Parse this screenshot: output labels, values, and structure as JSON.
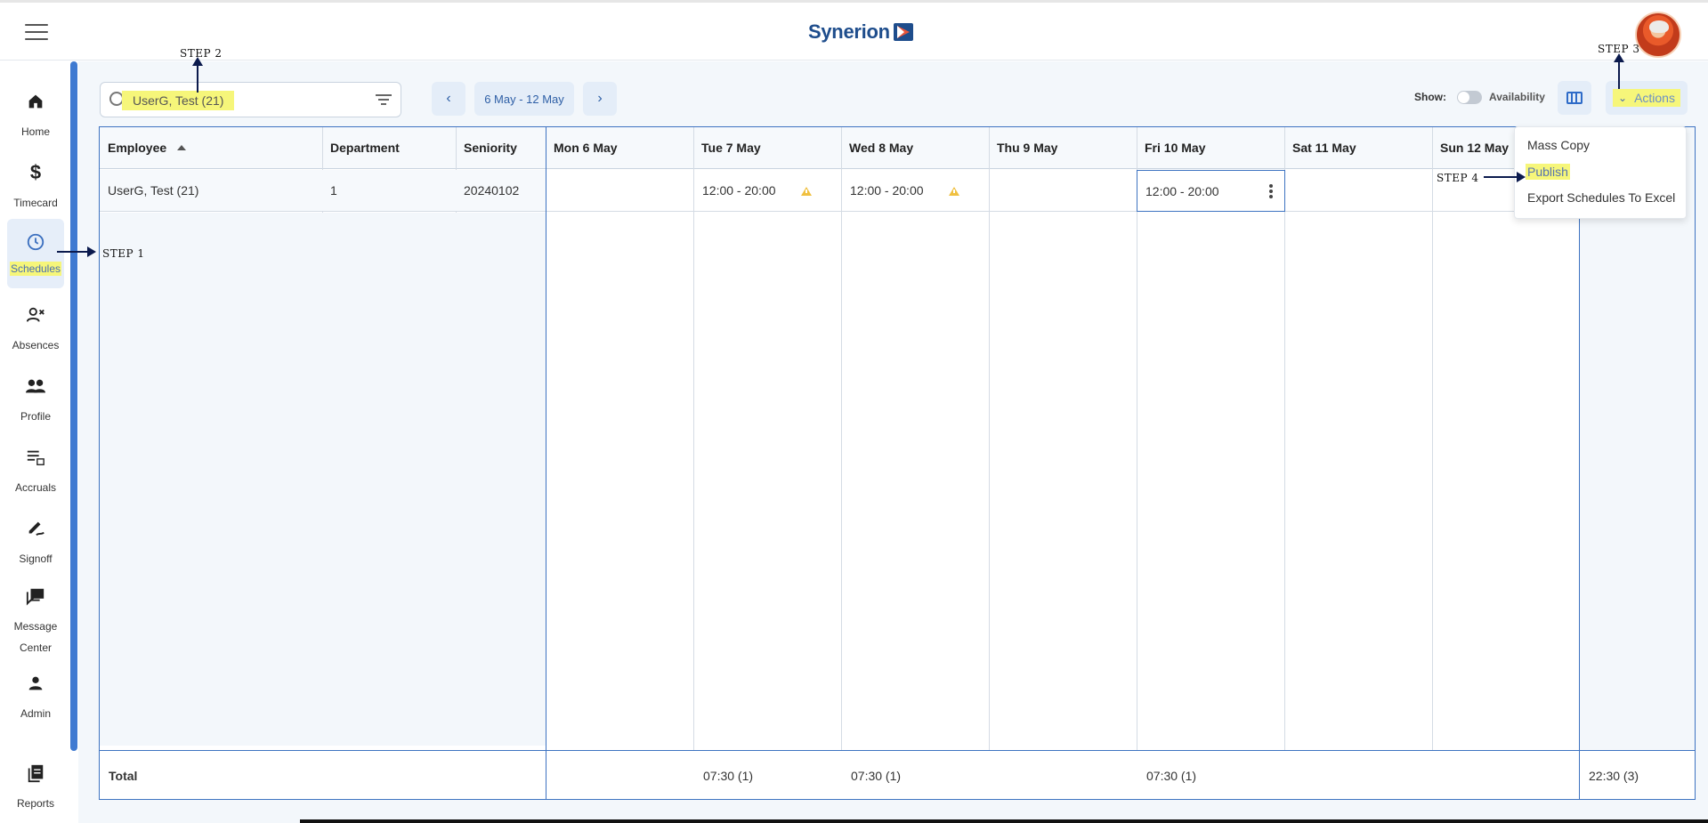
{
  "app": {
    "brand": "Synerion"
  },
  "sidebar": {
    "items": [
      {
        "label": "Home",
        "icon": "home-icon",
        "glyph": "⌂"
      },
      {
        "label": "Timecard",
        "icon": "dollar-icon",
        "glyph": "$"
      },
      {
        "label": "Schedules",
        "icon": "clock-icon",
        "glyph": "◷"
      },
      {
        "label": "Absences",
        "icon": "person-remove-icon",
        "glyph": "⚇"
      },
      {
        "label": "Profile",
        "icon": "group-icon",
        "glyph": "👥"
      },
      {
        "label": "Accruals",
        "icon": "accruals-icon",
        "glyph": "☰"
      },
      {
        "label": "Signoff",
        "icon": "signoff-icon",
        "glyph": "✎"
      },
      {
        "label": "Message Center",
        "icon": "message-icon",
        "glyph": "▰"
      },
      {
        "label": "Admin",
        "icon": "admin-person-icon",
        "glyph": "●"
      },
      {
        "label": "Reports",
        "icon": "reports-icon",
        "glyph": "▤"
      }
    ]
  },
  "toolbar": {
    "search_value": "UserG, Test (21)",
    "date_range": "6 May - 12 May",
    "prev_glyph": "‹",
    "next_glyph": "›",
    "show_label": "Show:",
    "availability_label": "Availability",
    "availability_on": false,
    "actions_label": "Actions"
  },
  "grid": {
    "columns": [
      "Employee",
      "Department",
      "Seniority",
      "Mon 6 May",
      "Tue 7 May",
      "Wed 8 May",
      "Thu 9 May",
      "Fri 10 May",
      "Sat 11 May",
      "Sun 12 May"
    ],
    "row": {
      "employee": "UserG, Test (21)",
      "department": "1",
      "seniority": "20240102",
      "tue": "12:00 - 20:00",
      "wed": "12:00 - 20:00",
      "fri": "12:00 - 20:00"
    },
    "totals": {
      "label": "Total",
      "tue": "07:30 (1)",
      "wed": "07:30 (1)",
      "fri": "07:30 (1)",
      "summary": "22:30 (3)"
    }
  },
  "actions_menu": {
    "items": [
      "Mass Copy",
      "Publish",
      "Export Schedules To Excel"
    ]
  },
  "annotations": {
    "step1": "STEP 1",
    "step2": "STEP 2",
    "step3": "STEP 3",
    "step4": "STEP 4"
  },
  "colors": {
    "accent": "#3e73c1",
    "highlight": "#f6f67a",
    "warning": "#f0c040",
    "background": "#f3f7fb"
  }
}
